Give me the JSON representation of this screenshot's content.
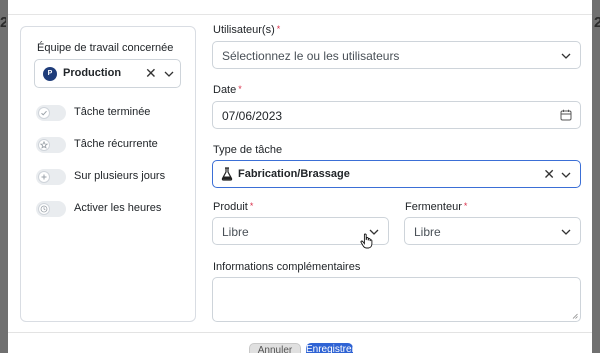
{
  "team": {
    "label": "Équipe de travail concernée",
    "avatar_letter": "P",
    "value": "Production",
    "clear_glyph": "✕"
  },
  "toggles": [
    {
      "label": "Tâche terminée",
      "icon": "check-icon",
      "on": false
    },
    {
      "label": "Tâche récurrente",
      "icon": "star-icon",
      "on": false
    },
    {
      "label": "Sur plusieurs jours",
      "icon": "plus-icon",
      "on": false
    },
    {
      "label": "Activer les heures",
      "icon": "clock-icon",
      "on": false
    }
  ],
  "users": {
    "label": "Utilisateur(s)",
    "required": "*",
    "placeholder": "Sélectionnez le ou les utilisateurs"
  },
  "date": {
    "label": "Date",
    "required": "*",
    "value": "07/06/2023"
  },
  "task_type": {
    "label": "Type de tâche",
    "value": "Fabrication/Brassage",
    "clear_glyph": "✕"
  },
  "product": {
    "label": "Produit",
    "required": "*",
    "value": "Libre"
  },
  "fermenter": {
    "label": "Fermenteur",
    "required": "*",
    "value": "Libre"
  },
  "extra_info": {
    "label": "Informations complémentaires",
    "value": ""
  },
  "footer": {
    "cancel_label": "Annuler",
    "save_label": "Enregistrer"
  },
  "colors": {
    "accent": "#2f63d4",
    "required": "#d9304a",
    "avatar": "#1f3d7a"
  }
}
